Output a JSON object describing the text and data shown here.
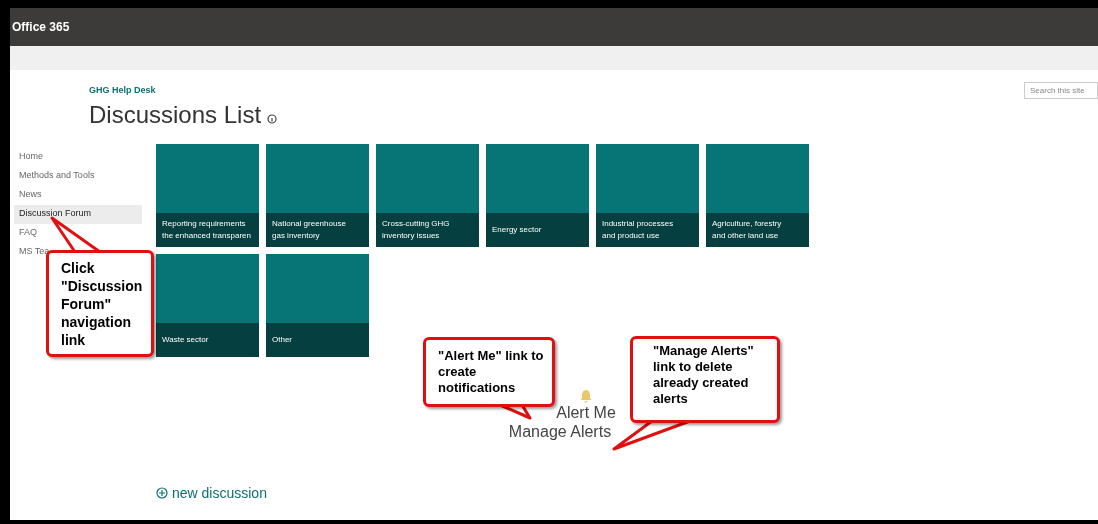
{
  "topbar": {
    "title": "Office 365"
  },
  "search": {
    "placeholder": "Search this site"
  },
  "site": {
    "name": "GHG Help Desk",
    "page_title": "Discussions List"
  },
  "nav": [
    {
      "label": "Home",
      "selected": false
    },
    {
      "label": "Methods and Tools",
      "selected": false
    },
    {
      "label": "News",
      "selected": false
    },
    {
      "label": "Discussion Forum",
      "selected": true
    },
    {
      "label": "FAQ",
      "selected": false
    },
    {
      "label": "MS Tea",
      "selected": false
    }
  ],
  "tiles": [
    {
      "lines": [
        "Reporting requirements",
        "the enhanced transparen"
      ]
    },
    {
      "lines": [
        "National greenhouse",
        "gas inventory"
      ]
    },
    {
      "lines": [
        "Cross-cutting GHG",
        "inventory issues"
      ]
    },
    {
      "lines": [
        "Energy sector"
      ]
    },
    {
      "lines": [
        "Industrial processes",
        "and product use"
      ]
    },
    {
      "lines": [
        "Agriculture, forestry",
        "and other land use"
      ]
    },
    {
      "lines": [
        "Waste sector"
      ]
    },
    {
      "lines": [
        "Other"
      ]
    }
  ],
  "alerts": {
    "alert_me": "Alert Me",
    "manage_alerts": "Manage Alerts"
  },
  "new_discussion": "new discussion",
  "callouts": [
    "Click \"Discussion Forum\" navigation link",
    "\"Alert Me\" link to create notifications",
    "\"Manage Alerts\" link to delete already created alerts"
  ]
}
